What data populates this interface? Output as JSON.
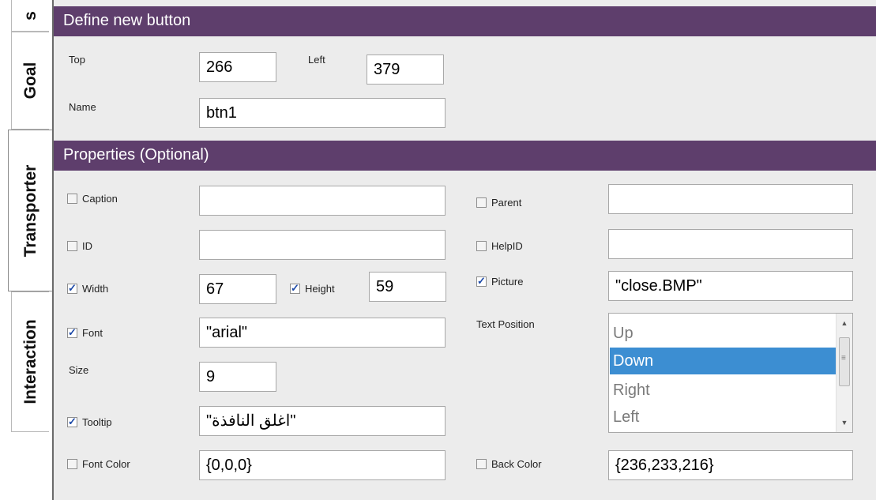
{
  "tabs": [
    {
      "label": "s"
    },
    {
      "label": "Goal"
    },
    {
      "label": "Transporter"
    },
    {
      "label": "Interaction"
    }
  ],
  "define_section": {
    "title": "Define new button",
    "top_label": "Top",
    "top_value": "266",
    "left_label": "Left",
    "left_value": "379",
    "name_label": "Name",
    "name_value": "btn1"
  },
  "properties_section": {
    "title": "Properties (Optional)",
    "caption_label": "Caption",
    "caption_checked": false,
    "caption_value": "",
    "id_label": "ID",
    "id_checked": false,
    "id_value": "",
    "width_label": "Width",
    "width_checked": true,
    "width_value": "67",
    "height_label": "Height",
    "height_checked": true,
    "height_value": "59",
    "font_label": "Font",
    "font_checked": true,
    "font_value": "\"arial\"",
    "size_label": "Size",
    "size_value": "9",
    "tooltip_label": "Tooltip",
    "tooltip_checked": true,
    "tooltip_value": "\"اغلق النافذة\"",
    "font_color_label": "Font Color",
    "font_color_checked": false,
    "font_color_value": "{0,0,0}",
    "parent_label": "Parent",
    "parent_checked": false,
    "parent_value": "",
    "helpid_label": "HelpID",
    "helpid_checked": false,
    "helpid_value": "",
    "picture_label": "Picture",
    "picture_checked": true,
    "picture_value": "\"close.BMP\"",
    "text_position_label": "Text Position",
    "text_position_options": [
      "Up",
      "Down",
      "Right",
      "Left"
    ],
    "text_position_selected": "Down",
    "back_color_label": "Back Color",
    "back_color_checked": false,
    "back_color_value": "{236,233,216}"
  },
  "colors": {
    "section_bar": "#5e3e6c",
    "selection": "#3c8ed2"
  }
}
